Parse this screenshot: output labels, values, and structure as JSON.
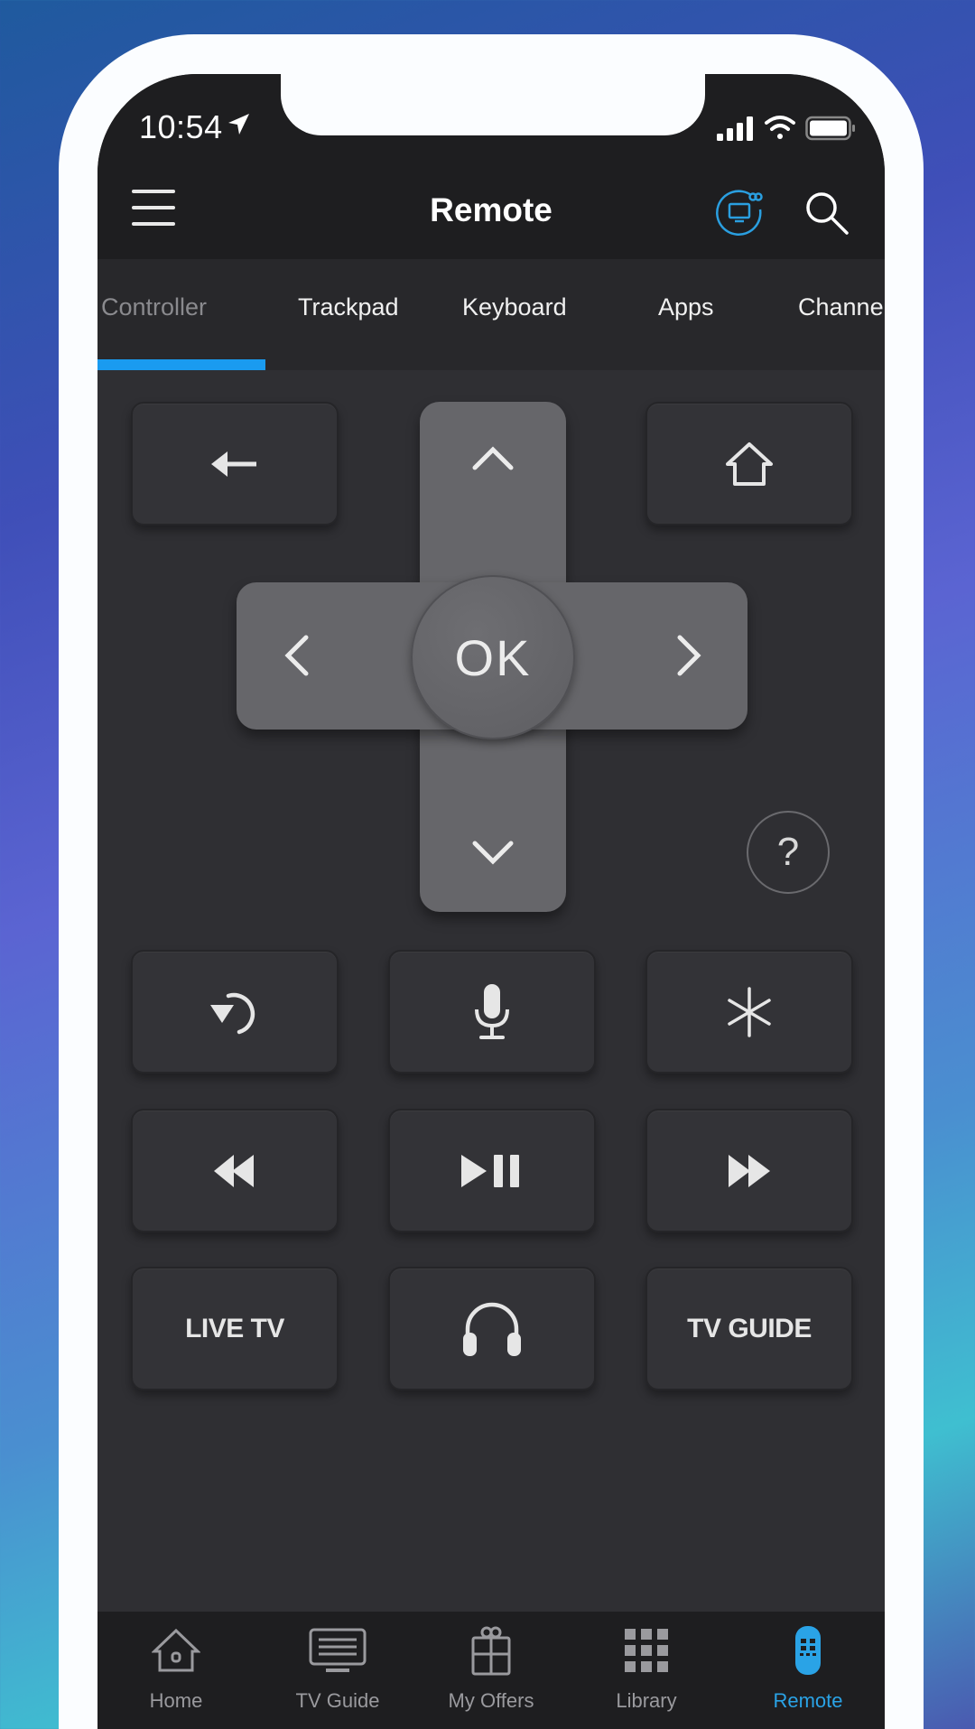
{
  "status_bar": {
    "time": "10:54",
    "icons": [
      "location-arrow-icon",
      "signal-icon",
      "wifi-icon",
      "battery-icon"
    ]
  },
  "header": {
    "title": "Remote",
    "icons": {
      "menu": "hamburger-menu-icon",
      "device": "tv-connected-icon",
      "search": "search-icon"
    },
    "accent_color": "#2a9fe0"
  },
  "tabs": {
    "items": [
      {
        "label": "Controller",
        "active": true
      },
      {
        "label": "Trackpad",
        "active": false
      },
      {
        "label": "Keyboard",
        "active": false
      },
      {
        "label": "Apps",
        "active": false
      },
      {
        "label": "Channe",
        "active": false
      }
    ],
    "indicator_color": "#1a9bf0"
  },
  "remote": {
    "back": {
      "icon": "back-arrow-icon"
    },
    "home": {
      "icon": "home-icon"
    },
    "dpad": {
      "up": "chevron-up-icon",
      "down": "chevron-down-icon",
      "left": "chevron-left-icon",
      "right": "chevron-right-icon",
      "ok_label": "OK"
    },
    "help_label": "?",
    "buttons": [
      {
        "name": "instant-replay",
        "icon": "replay-icon"
      },
      {
        "name": "voice",
        "icon": "microphone-icon"
      },
      {
        "name": "options",
        "icon": "asterisk-icon"
      },
      {
        "name": "rewind",
        "icon": "rewind-icon"
      },
      {
        "name": "play-pause",
        "icon": "play-pause-icon"
      },
      {
        "name": "fast-forward",
        "icon": "fast-forward-icon"
      },
      {
        "name": "live-tv",
        "label": "LIVE TV"
      },
      {
        "name": "private-listening",
        "icon": "headphones-icon"
      },
      {
        "name": "tv-guide",
        "label": "TV GUIDE"
      }
    ]
  },
  "bottom_nav": {
    "items": [
      {
        "label": "Home",
        "icon": "home-icon",
        "active": false
      },
      {
        "label": "TV Guide",
        "icon": "tv-guide-icon",
        "active": false
      },
      {
        "label": "My Offers",
        "icon": "gift-icon",
        "active": false
      },
      {
        "label": "Library",
        "icon": "grid-icon",
        "active": false
      },
      {
        "label": "Remote",
        "icon": "remote-icon",
        "active": true
      }
    ],
    "active_color": "#2aa3e6"
  }
}
